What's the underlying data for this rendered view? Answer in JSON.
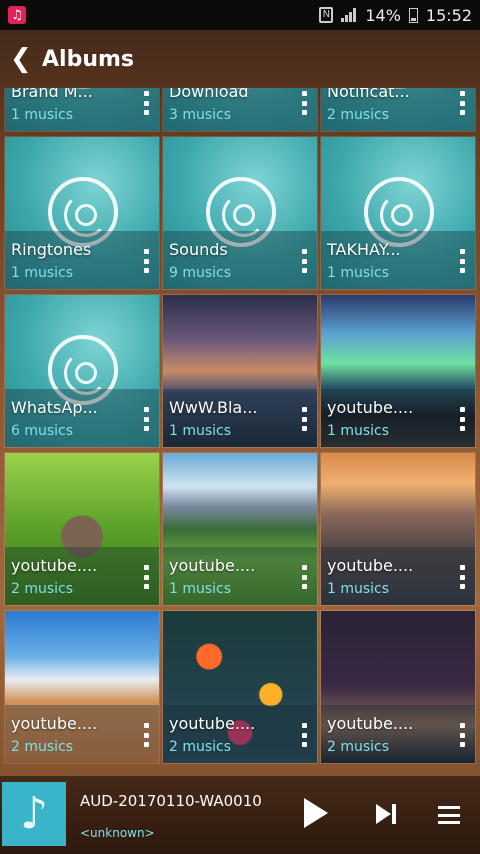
{
  "status_bar": {
    "battery": "14%",
    "time": "15:52",
    "nfc": "N"
  },
  "header": {
    "title": "Albums"
  },
  "albums": [
    {
      "name": "Brand M...",
      "count": "1 musics",
      "art": "art-teal",
      "icon": "disc"
    },
    {
      "name": "Download",
      "count": "3 musics",
      "art": "art-teal",
      "icon": "disc"
    },
    {
      "name": "Notificat...",
      "count": "2 musics",
      "art": "art-teal",
      "icon": "disc"
    },
    {
      "name": "Ringtones",
      "count": "1 musics",
      "art": "art-teal",
      "icon": "disc"
    },
    {
      "name": "Sounds",
      "count": "9 musics",
      "art": "art-teal",
      "icon": "disc"
    },
    {
      "name": "TAKHAY...",
      "count": "1 musics",
      "art": "art-teal",
      "icon": "disc"
    },
    {
      "name": "WhatsAp...",
      "count": "6 musics",
      "art": "art-teal",
      "icon": "disc"
    },
    {
      "name": "WwW.Bla...",
      "count": "1 musics",
      "art": "art-ocean",
      "icon": "photo"
    },
    {
      "name": "youtube....",
      "count": "1 musics",
      "art": "art-aurora",
      "icon": "photo"
    },
    {
      "name": "youtube....",
      "count": "2 musics",
      "art": "art-rabbit",
      "icon": "photo"
    },
    {
      "name": "youtube....",
      "count": "1 musics",
      "art": "art-valley",
      "icon": "photo"
    },
    {
      "name": "youtube....",
      "count": "1 musics",
      "art": "art-city",
      "icon": "photo"
    },
    {
      "name": "youtube....",
      "count": "2 musics",
      "art": "art-desert",
      "icon": "photo"
    },
    {
      "name": "youtube....",
      "count": "2 musics",
      "art": "art-lanterns",
      "icon": "photo"
    },
    {
      "name": "youtube....",
      "count": "2 musics",
      "art": "art-night",
      "icon": "photo"
    }
  ],
  "player": {
    "title": "AUD-20170110-WA0010",
    "artist": "<unknown>"
  },
  "icons": {
    "back": "chevron-left-icon",
    "more": "more-vertical-icon",
    "disc": "disc-icon",
    "note": "music-note-icon",
    "play": "play-icon",
    "next": "skip-next-icon",
    "queue": "queue-icon"
  },
  "colors": {
    "accent": "#7fe0e8",
    "thumb": "#3ab4c8",
    "status_bar": "#0d0b0a"
  }
}
